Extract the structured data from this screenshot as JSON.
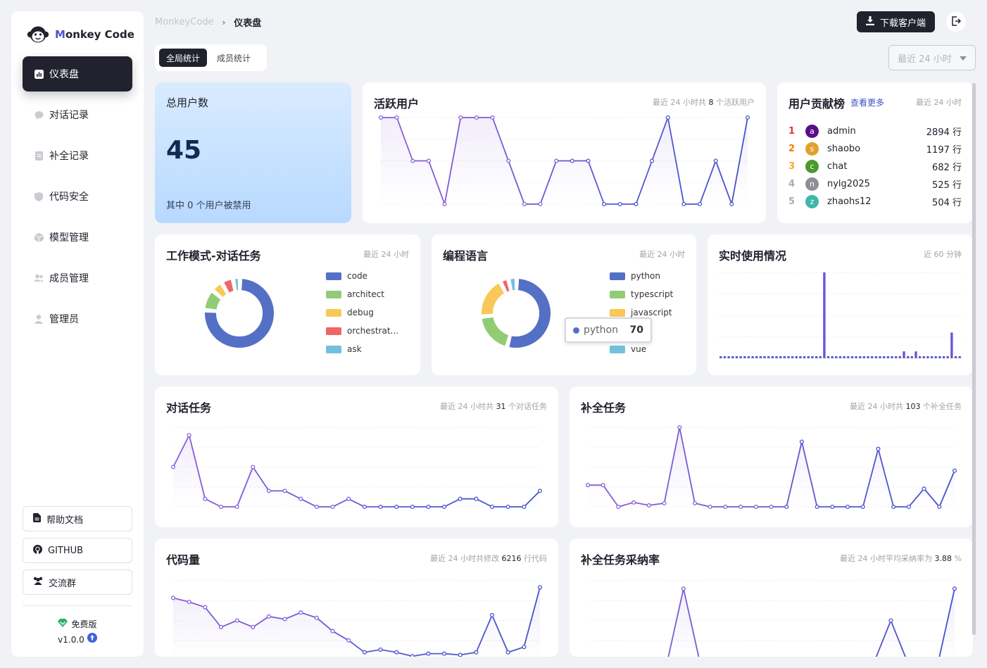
{
  "app": {
    "logo_m": "M",
    "logo_rest": "onkey Code"
  },
  "breadcrumb": {
    "root": "MonkeyCode",
    "sep": "›",
    "current": "仪表盘"
  },
  "header": {
    "download_label": "下载客户端"
  },
  "sidebar": {
    "items": [
      {
        "label": "仪表盘",
        "icon": "chart-icon",
        "active": true
      },
      {
        "label": "对话记录",
        "icon": "chat-icon"
      },
      {
        "label": "补全记录",
        "icon": "document-icon"
      },
      {
        "label": "代码安全",
        "icon": "shield-icon"
      },
      {
        "label": "模型管理",
        "icon": "cube-icon"
      },
      {
        "label": "成员管理",
        "icon": "users-icon"
      },
      {
        "label": "管理员",
        "icon": "user-icon"
      }
    ],
    "buttons": [
      {
        "label": "帮助文档",
        "icon": "doc-icon"
      },
      {
        "label": "GITHUB",
        "icon": "github-icon"
      },
      {
        "label": "交流群",
        "icon": "group-icon"
      }
    ],
    "edition": "免费版",
    "version": "v1.0.0"
  },
  "tabs": [
    {
      "label": "全局统计",
      "active": true
    },
    {
      "label": "成员统计"
    }
  ],
  "range_select": {
    "value": "最近 24 小时"
  },
  "total_users": {
    "title": "总用户数",
    "value": "45",
    "note": "其中 0 个用户被禁用"
  },
  "active_users": {
    "title": "活跃用户",
    "sub_pre": "最近 24 小时共",
    "sub_num": "8",
    "sub_post": "个活跃用户"
  },
  "leaderboard": {
    "title": "用户贡献榜",
    "more": "查看更多",
    "sub": "最近 24 小时",
    "rows": [
      {
        "rank": "1",
        "avatar": "a",
        "name": "admin",
        "value": "2894 行",
        "color": "#5a0f8a",
        "rank_color": "#e53935"
      },
      {
        "rank": "2",
        "avatar": "s",
        "name": "shaobo",
        "value": "1197 行",
        "color": "#e0a22a",
        "rank_color": "#f57c00"
      },
      {
        "rank": "3",
        "avatar": "c",
        "name": "chat",
        "value": "682 行",
        "color": "#4b9a2e",
        "rank_color": "#f9a825"
      },
      {
        "rank": "4",
        "avatar": "n",
        "name": "nylg2025",
        "value": "525 行",
        "color": "#8e8e99",
        "rank_color": "#a9abb3"
      },
      {
        "rank": "5",
        "avatar": "z",
        "name": "zhaohs12",
        "value": "504 行",
        "color": "#3fb6a8",
        "rank_color": "#a9abb3"
      }
    ]
  },
  "work_mode": {
    "title": "工作模式-对话任务",
    "sub": "最近 24 小时"
  },
  "languages": {
    "title": "编程语言",
    "sub": "最近 24 小时",
    "tooltip": {
      "name": "python",
      "value": "70"
    }
  },
  "realtime": {
    "title": "实时使用情况",
    "sub": "近 60 分钟"
  },
  "chat_tasks": {
    "title": "对话任务",
    "sub_pre": "最近 24 小时共",
    "sub_num": "31",
    "sub_post": "个对话任务"
  },
  "completion_tasks": {
    "title": "补全任务",
    "sub_pre": "最近 24 小时共",
    "sub_num": "103",
    "sub_post": "个补全任务"
  },
  "code_volume": {
    "title": "代码量",
    "sub_pre": "最近 24 小时共修改",
    "sub_num": "6216",
    "sub_post": "行代码"
  },
  "accept_rate": {
    "title": "补全任务采纳率",
    "sub_pre": "最近 24 小时平均采纳率为",
    "sub_num": "3.88",
    "sub_post": "%"
  },
  "chart_data": [
    {
      "id": "active_users",
      "type": "line",
      "x_count": 24,
      "values": [
        3,
        3,
        2,
        2,
        1,
        3,
        3,
        3,
        2,
        1,
        1,
        2,
        2,
        2,
        1,
        1,
        1,
        2,
        3,
        1,
        1,
        2,
        1,
        3
      ],
      "ylim": [
        1,
        3
      ]
    },
    {
      "id": "work_mode",
      "type": "pie",
      "slices": [
        {
          "label": "code",
          "value": 70,
          "color": "#5470c6"
        },
        {
          "label": "architect",
          "value": 9,
          "color": "#91cc75"
        },
        {
          "label": "debug",
          "value": 5,
          "color": "#fac858"
        },
        {
          "label": "orchestrat...",
          "value": 5,
          "color": "#ee6666"
        },
        {
          "label": "ask",
          "value": 3,
          "color": "#73c0de"
        }
      ]
    },
    {
      "id": "languages",
      "type": "pie",
      "slices": [
        {
          "label": "python",
          "value": 70,
          "color": "#5470c6"
        },
        {
          "label": "typescript",
          "value": 25,
          "color": "#91cc75"
        },
        {
          "label": "javascript",
          "value": 25,
          "color": "#fac858"
        },
        {
          "label": "",
          "value": 5,
          "color": "#ee6666"
        },
        {
          "label": "vue",
          "value": 5,
          "color": "#73c0de"
        }
      ]
    },
    {
      "id": "realtime",
      "type": "bar",
      "x_count": 60,
      "values": [
        0,
        0,
        0,
        0,
        0,
        0,
        0,
        0,
        0,
        0,
        0,
        0,
        0,
        0,
        0,
        0,
        0,
        0,
        0,
        0,
        0,
        0,
        0,
        0,
        0,
        0,
        10,
        0,
        0,
        0,
        0,
        0,
        0,
        0,
        0,
        0,
        0,
        0,
        0,
        0,
        0,
        0,
        0,
        0,
        0,
        0,
        0.8,
        0,
        0,
        0.8,
        0,
        0,
        0,
        0,
        0,
        0,
        0,
        0,
        3,
        0,
        0
      ],
      "ylim": [
        0,
        10
      ]
    },
    {
      "id": "chat_tasks",
      "type": "line",
      "x_count": 24,
      "values": [
        5,
        9,
        1,
        0,
        0,
        5,
        2,
        2,
        1,
        0,
        0,
        1,
        0,
        0,
        0,
        0,
        0,
        0,
        1,
        1,
        0,
        0,
        0,
        2
      ],
      "ylim": [
        0,
        10
      ]
    },
    {
      "id": "completion_tasks",
      "type": "line",
      "x_count": 24,
      "values": [
        3,
        3,
        0,
        0.6,
        0.2,
        0.5,
        11,
        0.5,
        0,
        0,
        0,
        0,
        0,
        0,
        9,
        0,
        0,
        0,
        0,
        8,
        0,
        0,
        2.5,
        0,
        5
      ],
      "ylim": [
        0,
        11
      ]
    },
    {
      "id": "code_volume",
      "type": "line",
      "x_count": 24,
      "values": [
        470,
        440,
        400,
        250,
        300,
        250,
        330,
        310,
        360,
        320,
        220,
        150,
        60,
        80,
        60,
        30,
        50,
        50,
        40,
        60,
        340,
        60,
        100,
        550
      ],
      "ylim": [
        0,
        600
      ]
    },
    {
      "id": "accept_rate",
      "type": "line",
      "x_count": 24,
      "values": [
        0,
        0,
        0,
        0,
        0,
        0,
        9,
        0,
        0,
        0,
        0,
        0,
        0,
        0,
        0,
        0,
        0,
        0,
        0,
        5,
        0,
        0,
        0,
        9
      ],
      "ylim": [
        0,
        10
      ]
    }
  ]
}
